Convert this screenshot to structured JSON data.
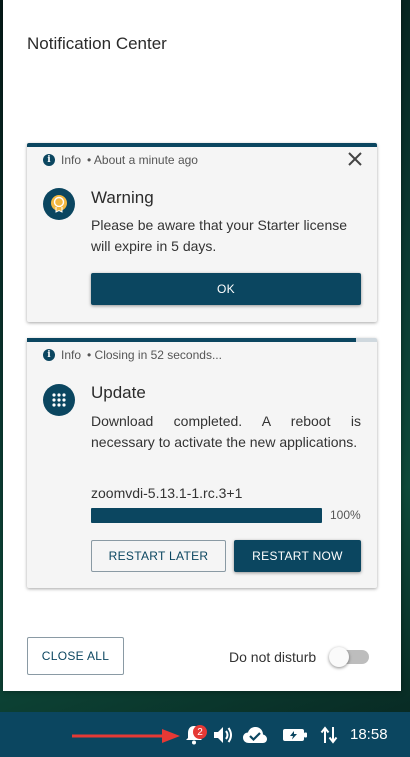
{
  "panel": {
    "title": "Notification Center"
  },
  "notifications": [
    {
      "level": "Info",
      "time": "• About a minute ago",
      "heading": "Warning",
      "body": "Please be aware that your Starter license will expire in 5 days.",
      "ok_label": "OK",
      "icon": "license-badge-icon"
    },
    {
      "level": "Info",
      "time": "• Closing in 52 seconds...",
      "heading": "Update",
      "body": "Download completed. A reboot is necessary to activate the new applications.",
      "package": "zoomvdi-5.13.1-1.rc.3+1",
      "progress": 1.0,
      "progress_label": "100%",
      "countdown_remaining": 0.94,
      "restart_later_label": "RESTART LATER",
      "restart_now_label": "RESTART NOW",
      "icon": "apps-grid-icon"
    }
  ],
  "footer": {
    "close_all_label": "CLOSE ALL",
    "dnd_label": "Do not disturb",
    "dnd_enabled": false
  },
  "taskbar": {
    "notification_count": "2",
    "clock": "18:58",
    "icons": [
      "bell-icon",
      "volume-icon",
      "cloud-check-icon",
      "battery-icon",
      "network-transfer-icon"
    ]
  },
  "colors": {
    "primary": "#0b4660",
    "badge": "#e53935",
    "arrow": "#e53935"
  }
}
